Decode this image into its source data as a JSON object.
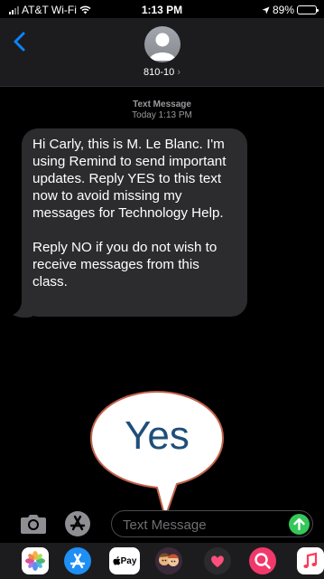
{
  "status_bar": {
    "carrier": "AT&T Wi-Fi",
    "time": "1:13 PM",
    "battery": "89%",
    "battery_level": 0.89
  },
  "header": {
    "contact": "810-10",
    "chevron": "›"
  },
  "conversation": {
    "meta_title": "Text Message",
    "meta_time": "Today 1:13 PM",
    "message_paragraph_1": "Hi Carly, this is M. Le Blanc. I'm using Remind to send important updates. Reply YES to this text now to avoid missing my messages for Technology Help.",
    "message_paragraph_2": "Reply NO if you do not wish to receive messages from this class."
  },
  "annotation": {
    "callout_text": "Yes"
  },
  "input": {
    "placeholder": "Text Message"
  },
  "app_drawer": {
    "apple_pay_label": "Pay",
    "icons": [
      "photos-icon",
      "app-store-icon",
      "apple-pay-icon",
      "memoji-icon",
      "digital-touch-icon",
      "image-search-icon",
      "music-icon"
    ]
  },
  "colors": {
    "accent_blue": "#0a84ff",
    "send_green": "#34c759",
    "bubble_gray": "#2c2c2e",
    "callout_text": "#1e4f7a",
    "callout_stroke": "#c0624a"
  }
}
